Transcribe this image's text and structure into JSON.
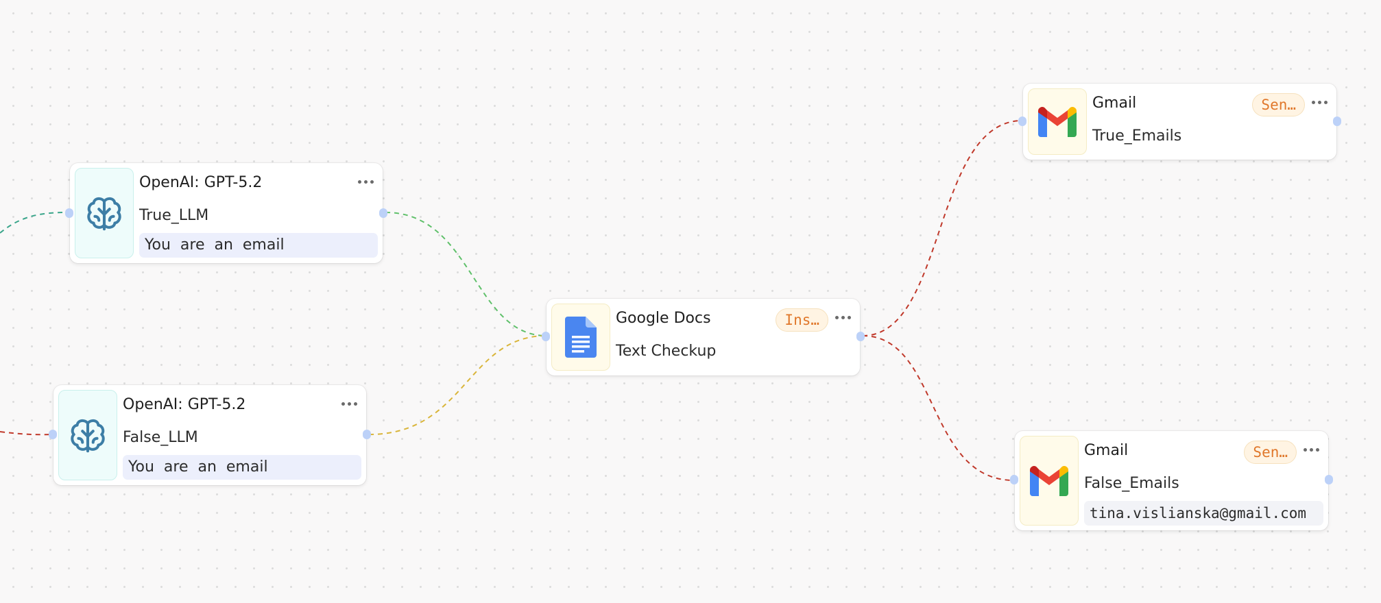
{
  "nodes": {
    "true_llm": {
      "title": "OpenAI: GPT-5.2",
      "name": "True_LLM",
      "prompt": "You  are  an  email",
      "icon": "brain-icon"
    },
    "false_llm": {
      "title": "OpenAI: GPT-5.2",
      "name": "False_LLM",
      "prompt": "You  are  an  email",
      "icon": "brain-icon"
    },
    "google_docs": {
      "title": "Google Docs",
      "name": "Text Checkup",
      "badge": "Ins…",
      "icon": "google-docs-icon"
    },
    "gmail_true": {
      "title": "Gmail",
      "name": "True_Emails",
      "badge": "Sen…",
      "icon": "gmail-icon"
    },
    "gmail_false": {
      "title": "Gmail",
      "name": "False_Emails",
      "recipient": "tina.vislianska@gmail.com",
      "badge": "Sen…",
      "icon": "gmail-icon"
    }
  },
  "colors": {
    "edge_green": "#5fc06a",
    "edge_yellow": "#d9b53a",
    "edge_red": "#c0392b",
    "edge_teal": "#3aa58a",
    "brain": "#3d7ea6",
    "badge_text": "#e0772a"
  }
}
